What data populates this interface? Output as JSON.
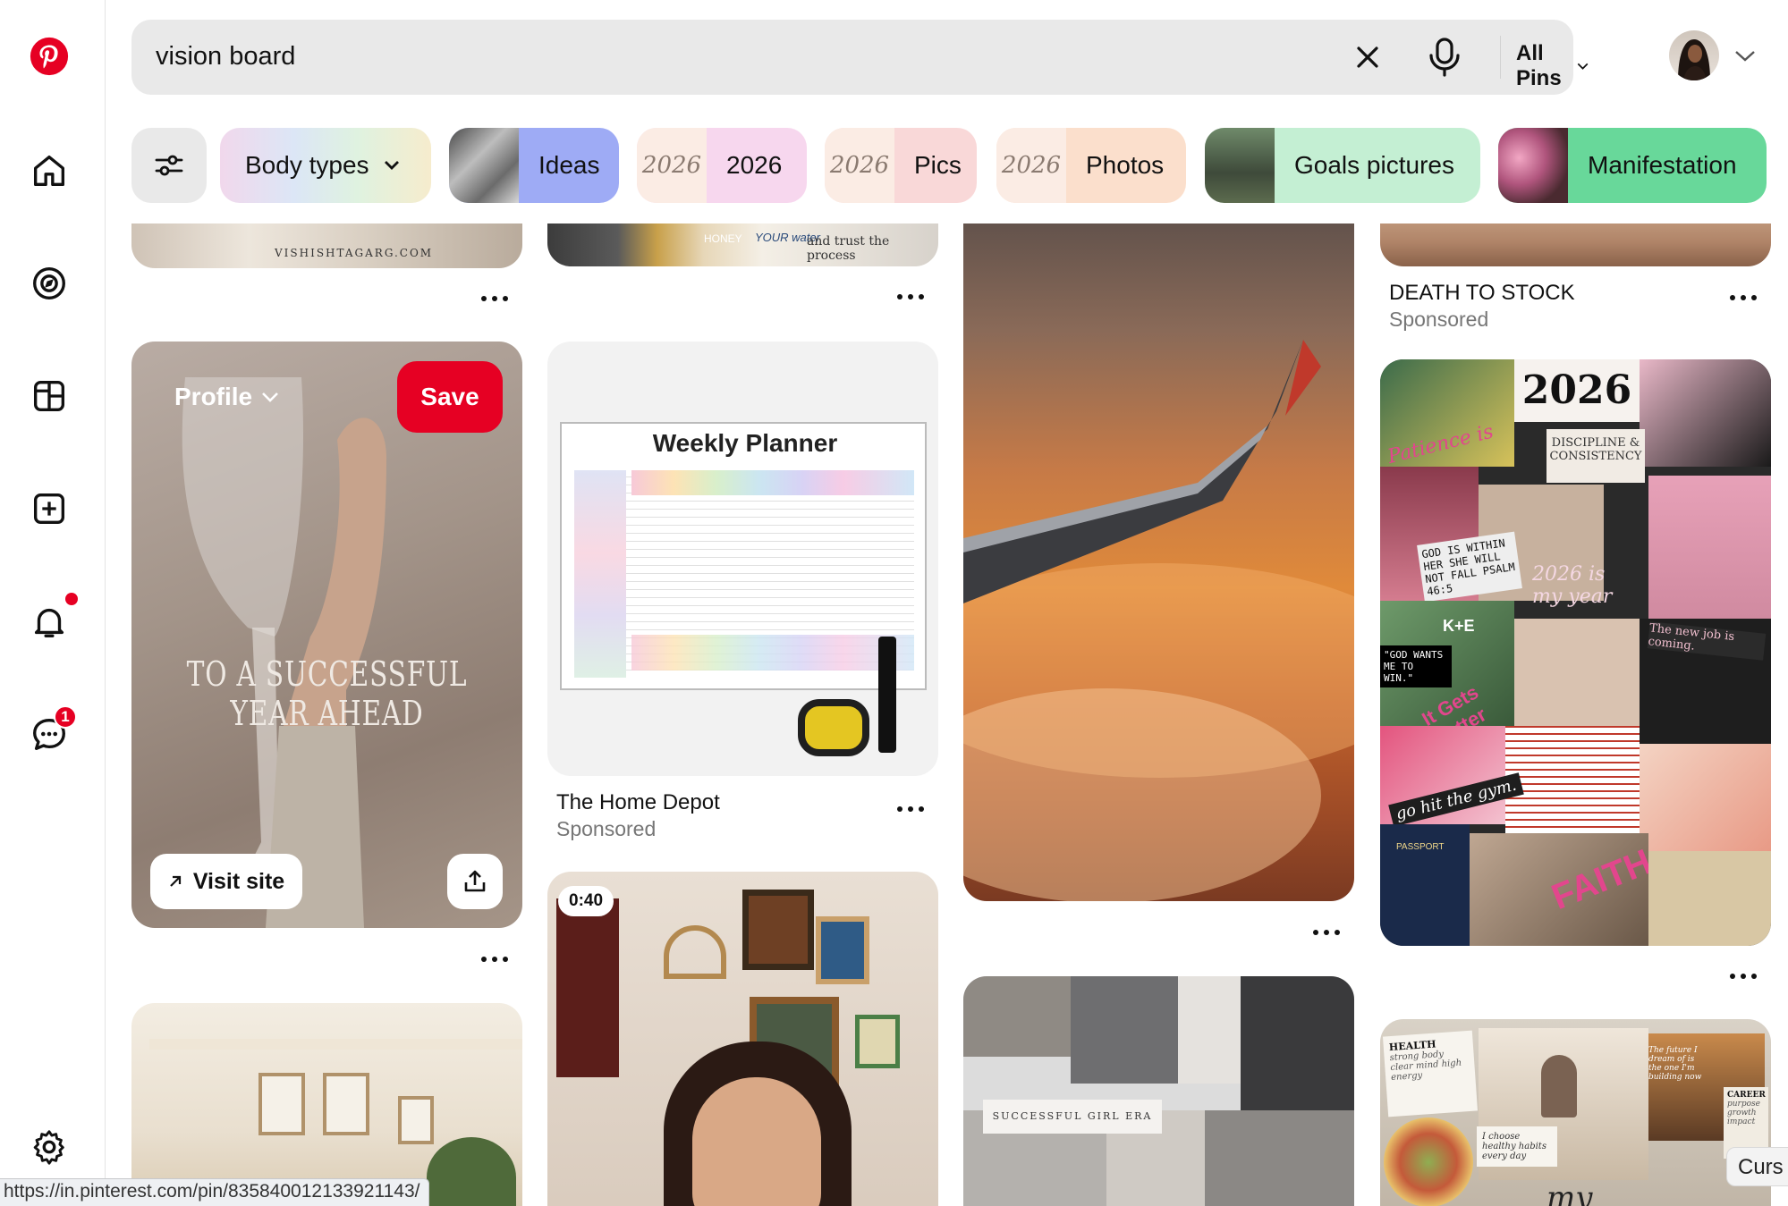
{
  "search": {
    "query": "vision board",
    "scope": "All Pins"
  },
  "chips": {
    "filter_icon": "sliders-icon",
    "items": [
      {
        "label": "Body types"
      },
      {
        "label": "Ideas"
      },
      {
        "label": "2026",
        "thumb": "2026"
      },
      {
        "label": "Pics",
        "thumb": "2026"
      },
      {
        "label": "Photos",
        "thumb": "2026"
      },
      {
        "label": "Goals pictures"
      },
      {
        "label": "Manifestation"
      }
    ]
  },
  "sidebar": {
    "items": [
      "pinterest-logo",
      "home-icon",
      "explore-icon",
      "boards-icon",
      "create-icon",
      "notifications-icon",
      "messages-icon",
      "settings-icon"
    ],
    "messages_badge": "1"
  },
  "pins": {
    "top_caption_1": "VISHISHTAGARG.COM",
    "top_caption_2a": "HONEY",
    "top_caption_2b": "YOUR water",
    "top_caption_2c": "and trust the process",
    "hovered": {
      "profile_label": "Profile",
      "save_label": "Save",
      "overlay_text": "TO A SUCCESSFUL YEAR AHEAD",
      "visit_label": "Visit site"
    },
    "planner": {
      "heading": "Weekly Planner",
      "title": "The Home Depot",
      "sub": "Sponsored"
    },
    "death_to_stock": {
      "title": "DEATH TO STOCK",
      "sub": "Sponsored"
    },
    "video_duration": "0:40",
    "collage": {
      "year": "2026",
      "t1": "Patience is key",
      "t2": "DISCIPLINE & CONSISTENCY",
      "t3": "GOD IS WITHIN HER SHE WILL NOT FALL PSALM 46:5",
      "t4": "2026 is my year",
      "t5": "K+E",
      "t6": "\"GOD WANTS ME TO WIN.\"",
      "t7": "It Gets Better",
      "t8": "The new job is coming.",
      "t9": "go hit the gym.",
      "t10": "FAITH",
      "t11": "PASSPORT"
    },
    "girl_era": "SUCCESSFUL GIRL ERA",
    "bottom_right": {
      "health": "HEALTH",
      "health_sub": "strong body clear mind high energy",
      "future": "The future I dream of is the one I'm building now",
      "career": "CAREER",
      "career_sub": "purpose growth impact",
      "healthy": "I choose healthy habits every day",
      "my": "my"
    }
  },
  "status_url": "https://in.pinterest.com/pin/835840012133921143/",
  "cursor_tag": "Curs",
  "colors": {
    "brand": "#e60023",
    "search_bg": "#e9e9e9"
  }
}
